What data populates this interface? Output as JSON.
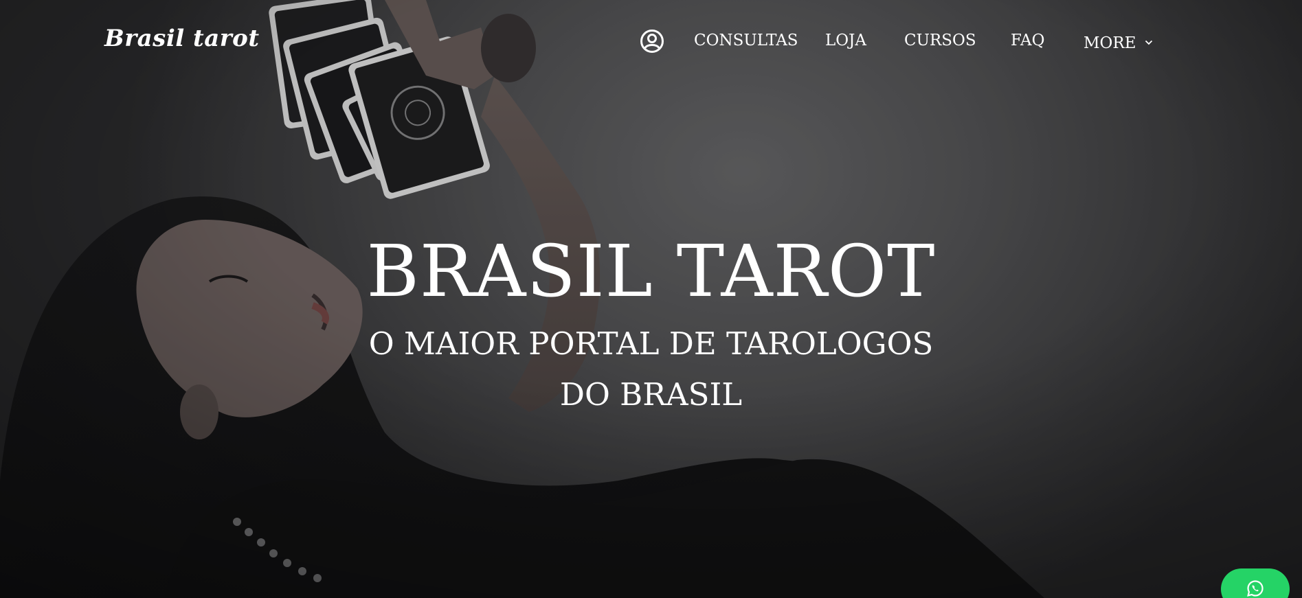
{
  "brand": {
    "logo_text": "Brasil tarot"
  },
  "nav": {
    "account_icon": "user-circle-icon",
    "items": [
      {
        "label": "CONSULTAS"
      },
      {
        "label": "LOJA"
      },
      {
        "label": "CURSOS"
      },
      {
        "label": "FAQ"
      }
    ],
    "more_label": "MORE",
    "more_icon": "chevron-down-icon"
  },
  "hero": {
    "title": "BRASIL TAROT",
    "subtitle": "O MAIOR PORTAL DE TAROLOGOS DO BRASIL"
  },
  "floating": {
    "whatsapp_icon": "whatsapp-icon",
    "whatsapp_color": "#25d366"
  },
  "colors": {
    "text": "#ffffff",
    "background": "#4a4a4c"
  }
}
